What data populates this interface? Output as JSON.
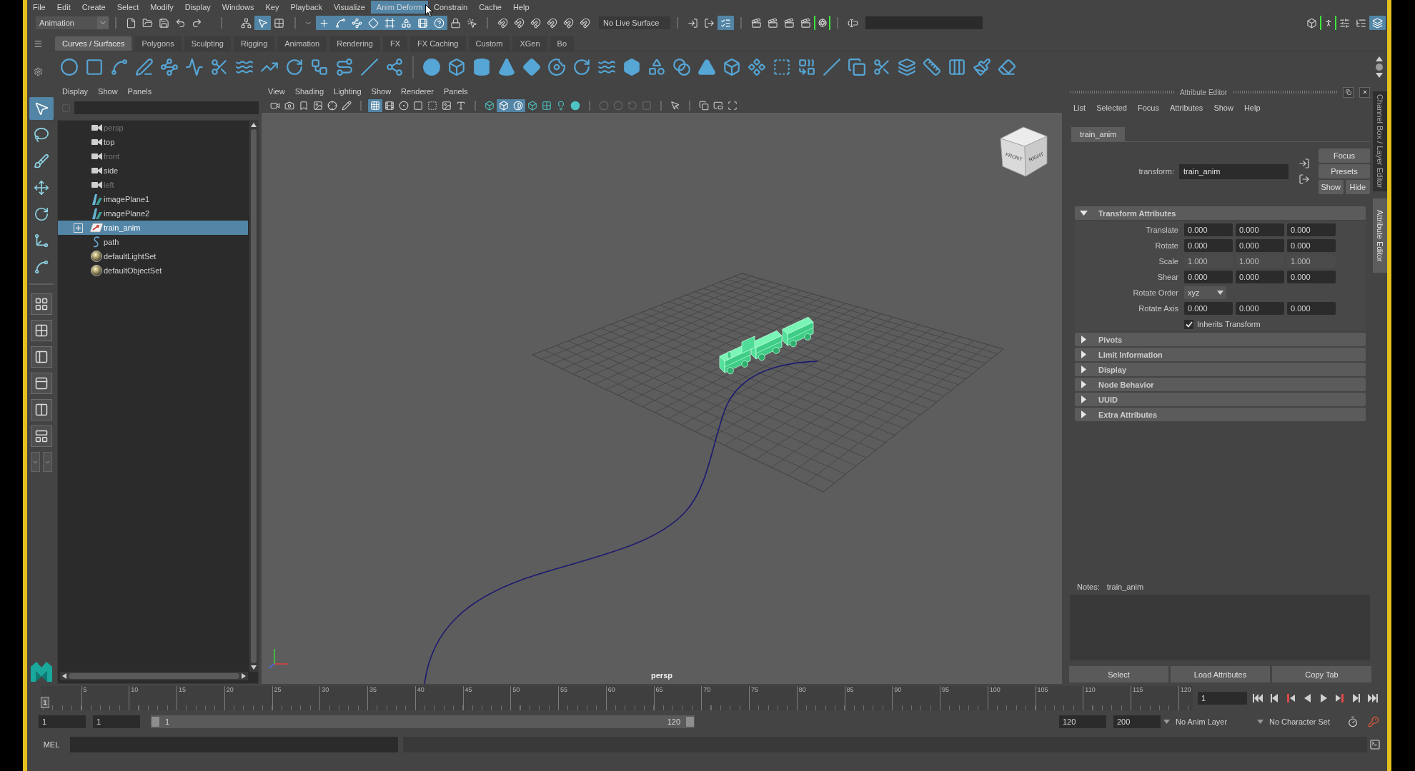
{
  "menu_bar": [
    {
      "label": "File",
      "selected": false
    },
    {
      "label": "Edit",
      "selected": false
    },
    {
      "label": "Create",
      "selected": false
    },
    {
      "label": "Select",
      "selected": false
    },
    {
      "label": "Modify",
      "selected": false
    },
    {
      "label": "Display",
      "selected": false
    },
    {
      "label": "Windows",
      "selected": false
    },
    {
      "label": "Key",
      "selected": false
    },
    {
      "label": "Playback",
      "selected": false
    },
    {
      "label": "Visualize",
      "selected": false
    },
    {
      "label": "Anim Deform",
      "selected": true
    },
    {
      "label": "Constrain",
      "selected": false
    },
    {
      "label": "Cache",
      "selected": false
    },
    {
      "label": "Help",
      "selected": false
    }
  ],
  "status_line": {
    "menu_set": "Animation",
    "live_surface": "No Live Surface",
    "tools": [
      {
        "on": false
      },
      {
        "on": false
      },
      {
        "on": false
      },
      {
        "on": false
      },
      {
        "on": false
      },
      {
        "on": false
      },
      {
        "on": true
      },
      {
        "on": false
      },
      {
        "on": true
      },
      {
        "on": true
      },
      {
        "on": true
      },
      {
        "on": true
      },
      {
        "on": true
      },
      {
        "on": true
      },
      {
        "on": true
      },
      {
        "on": true
      },
      {
        "on": false
      },
      {
        "on": false
      },
      {
        "on": false
      },
      {
        "on": false
      },
      {
        "on": false
      },
      {
        "on": false
      },
      {
        "on": false
      },
      {
        "on": false
      },
      {
        "on": false
      },
      {
        "on": false
      },
      {
        "on": true
      },
      {
        "on": false
      },
      {
        "on": false
      },
      {
        "on": false
      },
      {
        "on": false
      },
      {
        "on": false
      },
      {
        "on": false
      },
      {
        "on": false
      },
      {
        "on": false
      },
      {
        "on": false
      },
      {
        "on": false
      },
      {
        "on": true
      }
    ]
  },
  "shelf": {
    "tabs": [
      {
        "label": "Curves / Surfaces",
        "selected": true
      },
      {
        "label": "Polygons",
        "selected": false
      },
      {
        "label": "Sculpting",
        "selected": false
      },
      {
        "label": "Rigging",
        "selected": false
      },
      {
        "label": "Animation",
        "selected": false
      },
      {
        "label": "Rendering",
        "selected": false
      },
      {
        "label": "FX",
        "selected": false
      },
      {
        "label": "FX Caching",
        "selected": false
      },
      {
        "label": "Custom",
        "selected": false
      },
      {
        "label": "XGen",
        "selected": false
      },
      {
        "label": "Bo",
        "selected": false
      }
    ]
  },
  "toolbox": {
    "tools": [
      {
        "selected": true
      },
      {
        "selected": false
      },
      {
        "selected": false
      },
      {
        "selected": false
      },
      {
        "selected": false
      },
      {
        "selected": false
      },
      {
        "selected": false
      }
    ]
  },
  "outliner": {
    "menu": [
      "Display",
      "Show",
      "Panels"
    ],
    "items": [
      {
        "label": "persp",
        "kind": "camera",
        "dimmed": true,
        "selected": false
      },
      {
        "label": "top",
        "kind": "camera",
        "dimmed": false,
        "selected": false
      },
      {
        "label": "front",
        "kind": "camera",
        "dimmed": true,
        "selected": false
      },
      {
        "label": "side",
        "kind": "camera",
        "dimmed": false,
        "selected": false
      },
      {
        "label": "left",
        "kind": "camera",
        "dimmed": true,
        "selected": false
      },
      {
        "label": "imagePlane1",
        "kind": "image_plane",
        "dimmed": false,
        "selected": false
      },
      {
        "label": "imagePlane2",
        "kind": "image_plane",
        "dimmed": false,
        "selected": false
      },
      {
        "label": "train_anim",
        "kind": "transform",
        "dimmed": false,
        "selected": true,
        "expanded": false
      },
      {
        "label": "path",
        "kind": "curve",
        "dimmed": false,
        "selected": false
      },
      {
        "label": "defaultLightSet",
        "kind": "set",
        "dimmed": false,
        "selected": false
      },
      {
        "label": "defaultObjectSet",
        "kind": "set",
        "dimmed": false,
        "selected": false
      }
    ]
  },
  "viewport": {
    "menu": [
      "View",
      "Shading",
      "Lighting",
      "Show",
      "Renderer",
      "Panels"
    ],
    "toolbar": [
      {
        "on": false,
        "disabled": false
      },
      {
        "on": false,
        "disabled": false
      },
      {
        "on": false,
        "disabled": false
      },
      {
        "on": false,
        "disabled": false
      },
      {
        "on": false,
        "disabled": false
      },
      {
        "on": false,
        "disabled": false
      },
      {
        "on": true,
        "disabled": false
      },
      {
        "on": false,
        "disabled": false
      },
      {
        "on": false,
        "disabled": false
      },
      {
        "on": false,
        "disabled": false
      },
      {
        "on": false,
        "disabled": false
      },
      {
        "on": false,
        "disabled": false
      },
      {
        "on": false,
        "disabled": false
      },
      {
        "on": false,
        "disabled": false
      },
      {
        "on": true,
        "disabled": false
      },
      {
        "on": true,
        "disabled": false
      },
      {
        "on": false,
        "disabled": false
      },
      {
        "on": false,
        "disabled": false
      },
      {
        "on": false,
        "disabled": false
      },
      {
        "on": false,
        "disabled": false
      },
      {
        "on": false,
        "disabled": true
      },
      {
        "on": false,
        "disabled": true
      },
      {
        "on": false,
        "disabled": true
      },
      {
        "on": false,
        "disabled": true
      },
      {
        "on": false,
        "disabled": false
      },
      {
        "on": false,
        "disabled": false
      },
      {
        "on": false,
        "disabled": false
      },
      {
        "on": false,
        "disabled": false
      }
    ],
    "view_cube": [
      "FRONT",
      "RIGHT"
    ],
    "camera": "persp"
  },
  "attribute_editor": {
    "title": "Attribute Editor",
    "menu": [
      "List",
      "Selected",
      "Focus",
      "Attributes",
      "Show",
      "Help"
    ],
    "node_tabs": [
      {
        "label": "train_anim",
        "selected": true
      }
    ],
    "transform": {
      "label": "transform:",
      "value": "train_anim"
    },
    "buttons": [
      "Focus",
      "Presets",
      "Show",
      "Hide"
    ],
    "sections": [
      {
        "title": "Transform Attributes",
        "expanded": true,
        "rows": [
          {
            "kind": "vector",
            "label": "Translate",
            "disabled": false,
            "values": [
              "0.000",
              "0.000",
              "0.000"
            ]
          },
          {
            "kind": "vector",
            "label": "Rotate",
            "disabled": false,
            "values": [
              "0.000",
              "0.000",
              "0.000"
            ]
          },
          {
            "kind": "vector",
            "label": "Scale",
            "disabled": true,
            "values": [
              "1.000",
              "1.000",
              "1.000"
            ]
          },
          {
            "kind": "vector",
            "label": "Shear",
            "disabled": false,
            "values": [
              "0.000",
              "0.000",
              "0.000"
            ]
          },
          {
            "kind": "dropdown",
            "label": "Rotate Order",
            "value": "xyz"
          },
          {
            "kind": "vector",
            "label": "Rotate Axis",
            "disabled": false,
            "values": [
              "0.000",
              "0.000",
              "0.000"
            ]
          },
          {
            "kind": "checkbox",
            "label": "Inherits Transform",
            "checked": true
          }
        ]
      },
      {
        "title": "Pivots",
        "expanded": false
      },
      {
        "title": "Limit Information",
        "expanded": false
      },
      {
        "title": "Display",
        "expanded": false
      },
      {
        "title": "Node Behavior",
        "expanded": false
      },
      {
        "title": "UUID",
        "expanded": false
      },
      {
        "title": "Extra Attributes",
        "expanded": false
      }
    ],
    "notes": {
      "label": "Notes:",
      "value": "train_anim"
    },
    "footer_buttons": [
      "Select",
      "Load Attributes",
      "Copy Tab"
    ]
  },
  "side_tabs": [
    {
      "label": "Channel Box / Layer Editor",
      "selected": false
    },
    {
      "label": "Attribute Editor",
      "selected": true
    }
  ],
  "time_slider": {
    "ticks": [
      "5",
      "10",
      "15",
      "20",
      "25",
      "30",
      "35",
      "40",
      "45",
      "50",
      "55",
      "60",
      "65",
      "70",
      "75",
      "80",
      "85",
      "90",
      "95",
      "100",
      "105",
      "110",
      "115",
      "120"
    ],
    "marker": "1",
    "current_frame": "1"
  },
  "range_slider": {
    "animation_start": "1",
    "playback_start": "1",
    "range_start": "1",
    "range_end": "120",
    "playback_end": "120",
    "animation_end": "200",
    "anim_layer": "No Anim Layer",
    "character_set": "No Character Set"
  },
  "command_line": {
    "language": "MEL"
  }
}
